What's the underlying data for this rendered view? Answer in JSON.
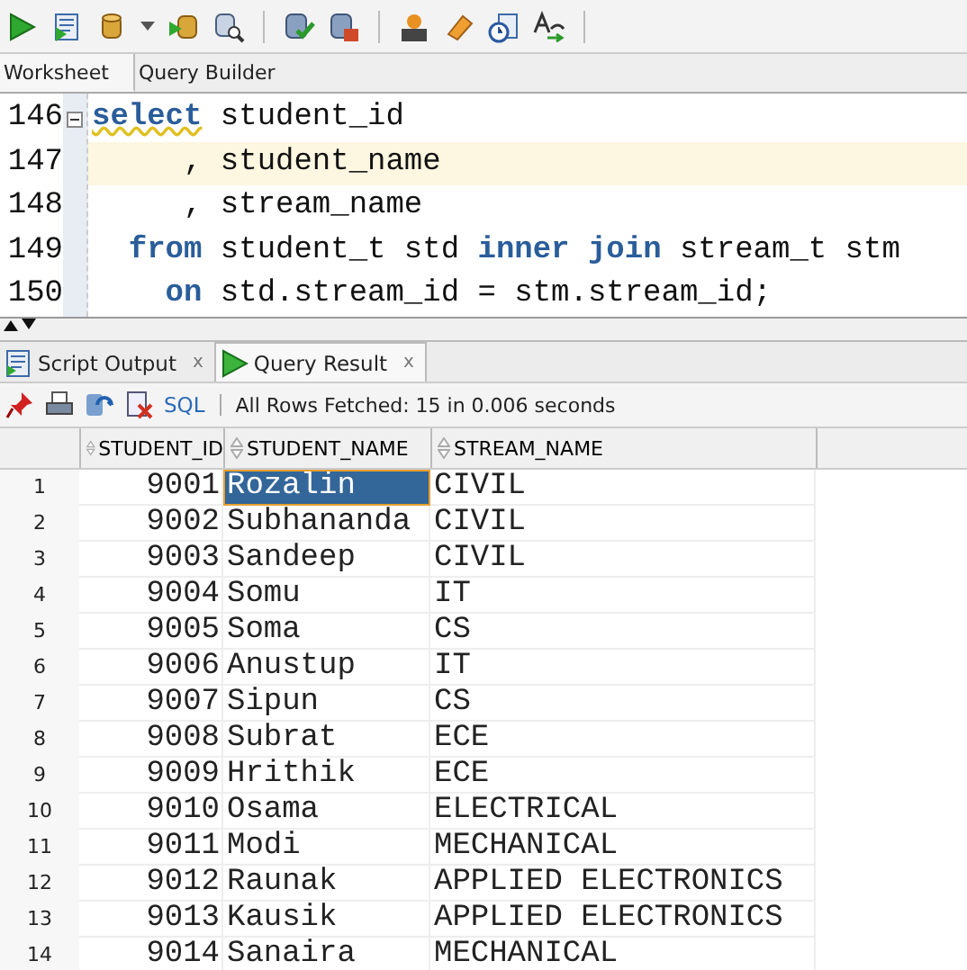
{
  "editor_tabs": [
    {
      "label": "Worksheet",
      "selected": true
    },
    {
      "label": "Query Builder",
      "selected": false
    }
  ],
  "editor": {
    "lines": [
      {
        "number": "146",
        "fold_marker": true,
        "current": false,
        "tokens": [
          {
            "text": "select",
            "kind": "keyword_warning"
          },
          {
            "text": " student_id",
            "kind": "plain"
          }
        ]
      },
      {
        "number": "147",
        "fold_marker": false,
        "current": true,
        "tokens": [
          {
            "text": "     , student_name",
            "kind": "plain"
          }
        ]
      },
      {
        "number": "148",
        "fold_marker": false,
        "current": false,
        "tokens": [
          {
            "text": "     , stream_name",
            "kind": "plain"
          }
        ]
      },
      {
        "number": "149",
        "fold_marker": false,
        "current": false,
        "tokens": [
          {
            "text": "  from",
            "kind": "keyword"
          },
          {
            "text": " student_t std ",
            "kind": "plain"
          },
          {
            "text": "inner join",
            "kind": "keyword"
          },
          {
            "text": " stream_t stm",
            "kind": "plain"
          }
        ]
      },
      {
        "number": "150",
        "fold_marker": false,
        "current": false,
        "tokens": [
          {
            "text": "    on",
            "kind": "keyword"
          },
          {
            "text": " std.stream_id = stm.stream_id;",
            "kind": "plain"
          }
        ]
      }
    ]
  },
  "output_tabs": [
    {
      "label": "Script Output",
      "close": "x",
      "selected": false,
      "kind": "script"
    },
    {
      "label": "Query Result",
      "close": "x",
      "selected": true,
      "kind": "result"
    }
  ],
  "result_toolbar": {
    "sql_link": "SQL",
    "status": "All Rows Fetched: 15 in 0.006 seconds"
  },
  "table": {
    "columns": [
      "STUDENT_ID",
      "STUDENT_NAME",
      "STREAM_NAME"
    ],
    "rows": [
      {
        "number": "1",
        "cells": [
          {
            "text": "9001",
            "selected": false
          },
          {
            "text": "Rozalin",
            "selected": true
          },
          {
            "text": "CIVIL",
            "selected": false
          }
        ]
      },
      {
        "number": "2",
        "cells": [
          {
            "text": "9002",
            "selected": false
          },
          {
            "text": "Subhananda",
            "selected": false
          },
          {
            "text": "CIVIL",
            "selected": false
          }
        ]
      },
      {
        "number": "3",
        "cells": [
          {
            "text": "9003",
            "selected": false
          },
          {
            "text": "Sandeep",
            "selected": false
          },
          {
            "text": "CIVIL",
            "selected": false
          }
        ]
      },
      {
        "number": "4",
        "cells": [
          {
            "text": "9004",
            "selected": false
          },
          {
            "text": "Somu",
            "selected": false
          },
          {
            "text": "IT",
            "selected": false
          }
        ]
      },
      {
        "number": "5",
        "cells": [
          {
            "text": "9005",
            "selected": false
          },
          {
            "text": "Soma",
            "selected": false
          },
          {
            "text": "CS",
            "selected": false
          }
        ]
      },
      {
        "number": "6",
        "cells": [
          {
            "text": "9006",
            "selected": false
          },
          {
            "text": "Anustup",
            "selected": false
          },
          {
            "text": "IT",
            "selected": false
          }
        ]
      },
      {
        "number": "7",
        "cells": [
          {
            "text": "9007",
            "selected": false
          },
          {
            "text": "Sipun",
            "selected": false
          },
          {
            "text": "CS",
            "selected": false
          }
        ]
      },
      {
        "number": "8",
        "cells": [
          {
            "text": "9008",
            "selected": false
          },
          {
            "text": "Subrat",
            "selected": false
          },
          {
            "text": "ECE",
            "selected": false
          }
        ]
      },
      {
        "number": "9",
        "cells": [
          {
            "text": "9009",
            "selected": false
          },
          {
            "text": "Hrithik",
            "selected": false
          },
          {
            "text": "ECE",
            "selected": false
          }
        ]
      },
      {
        "number": "10",
        "cells": [
          {
            "text": "9010",
            "selected": false
          },
          {
            "text": "Osama",
            "selected": false
          },
          {
            "text": "ELECTRICAL",
            "selected": false
          }
        ]
      },
      {
        "number": "11",
        "cells": [
          {
            "text": "9011",
            "selected": false
          },
          {
            "text": "Modi",
            "selected": false
          },
          {
            "text": "MECHANICAL",
            "selected": false
          }
        ]
      },
      {
        "number": "12",
        "cells": [
          {
            "text": "9012",
            "selected": false
          },
          {
            "text": "Raunak",
            "selected": false
          },
          {
            "text": "APPLIED ELECTRONICS",
            "selected": false
          }
        ]
      },
      {
        "number": "13",
        "cells": [
          {
            "text": "9013",
            "selected": false
          },
          {
            "text": "Kausik",
            "selected": false
          },
          {
            "text": "APPLIED ELECTRONICS",
            "selected": false
          }
        ]
      },
      {
        "number": "14",
        "cells": [
          {
            "text": "9014",
            "selected": false
          },
          {
            "text": "Sanaira",
            "selected": false
          },
          {
            "text": "MECHANICAL",
            "selected": false
          }
        ]
      }
    ]
  }
}
